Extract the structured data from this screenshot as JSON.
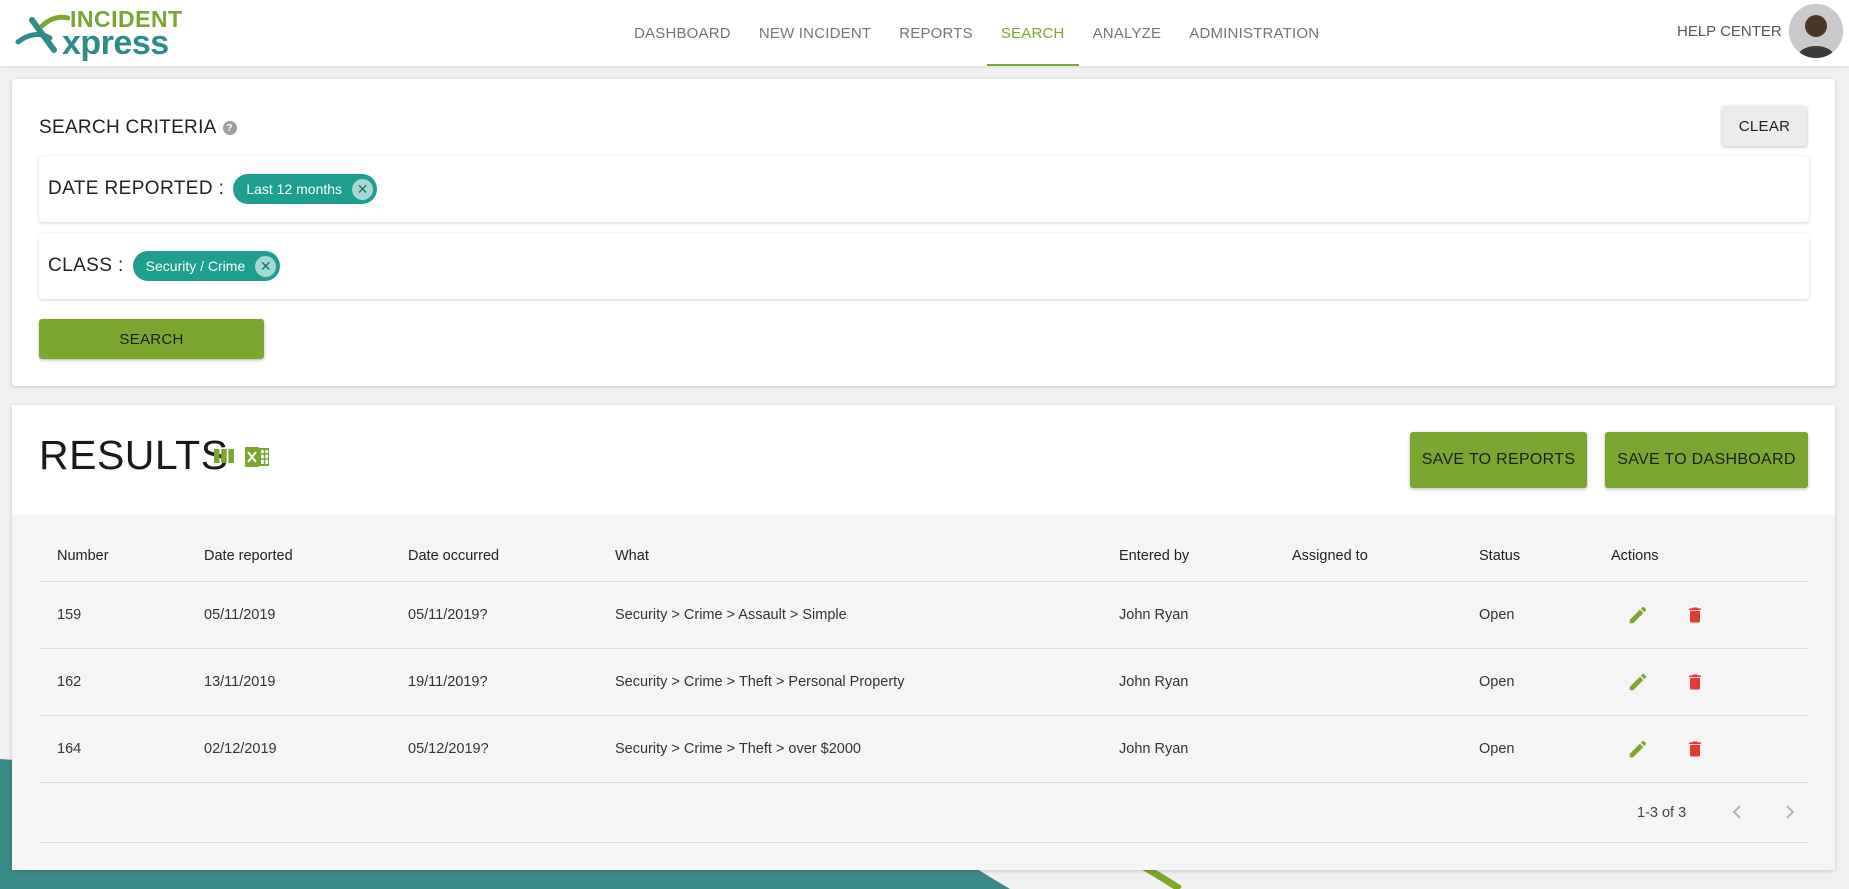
{
  "brand": {
    "logo_top": "INCIDENT",
    "logo_bottom": "xpress",
    "colors": {
      "green": "#7ba731",
      "teal": "#2e8b8a",
      "chip": "#1e9e8f",
      "delete": "#e53935"
    }
  },
  "nav": {
    "items": [
      {
        "label": "DASHBOARD",
        "active": false
      },
      {
        "label": "NEW INCIDENT",
        "active": false
      },
      {
        "label": "REPORTS",
        "active": false
      },
      {
        "label": "SEARCH",
        "active": true
      },
      {
        "label": "ANALYZE",
        "active": false
      },
      {
        "label": "ADMINISTRATION",
        "active": false
      }
    ],
    "help": "HELP CENTER"
  },
  "search": {
    "title": "SEARCH CRITERIA",
    "help_icon": "?",
    "clear_label": "CLEAR",
    "criteria": [
      {
        "label": "DATE REPORTED :",
        "chip": "Last 12 months"
      },
      {
        "label": "CLASS :",
        "chip": "Security / Crime"
      }
    ],
    "search_label": "SEARCH"
  },
  "results": {
    "title": "RESULTS",
    "save_reports_label": "SAVE TO REPORTS",
    "save_dashboard_label": "SAVE TO DASHBOARD",
    "columns": [
      "Number",
      "Date reported",
      "Date occurred",
      "What",
      "Entered by",
      "Assigned to",
      "Status",
      "Actions"
    ],
    "rows": [
      {
        "number": "159",
        "date_reported": "05/11/2019",
        "date_occurred": "05/11/2019?",
        "what": "Security > Crime > Assault > Simple",
        "entered_by": "John Ryan",
        "assigned_to": "",
        "status": "Open"
      },
      {
        "number": "162",
        "date_reported": "13/11/2019",
        "date_occurred": "19/11/2019?",
        "what": "Security > Crime > Theft > Personal Property",
        "entered_by": "John Ryan",
        "assigned_to": "",
        "status": "Open"
      },
      {
        "number": "164",
        "date_reported": "02/12/2019",
        "date_occurred": "05/12/2019?",
        "what": "Security > Crime > Theft > over $2000",
        "entered_by": "John Ryan",
        "assigned_to": "",
        "status": "Open"
      }
    ],
    "pagination": "1-3 of 3"
  }
}
